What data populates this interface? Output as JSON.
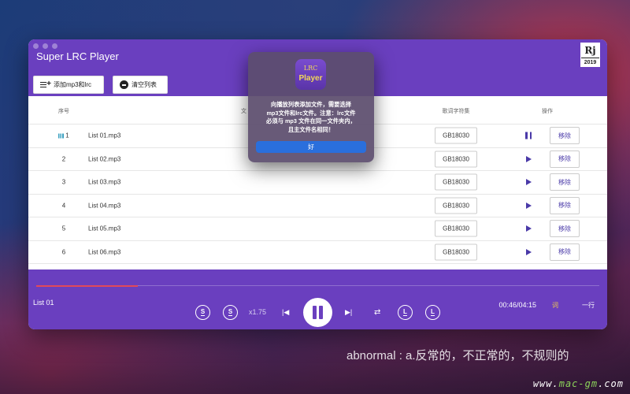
{
  "app": {
    "title": "Super LRC Player",
    "badge_top": "Rj",
    "badge_year": "2019"
  },
  "toolbar": {
    "add_label": "添加mp3和lrc",
    "clear_label": "清空列表"
  },
  "table": {
    "headers": {
      "no": "序号",
      "file": "文",
      "encoding": "歌词字符集",
      "ops": "操作"
    },
    "rows": [
      {
        "no": "1",
        "name": "List 01.mp3",
        "enc": "GB18030",
        "remove": "移除",
        "state": "playing"
      },
      {
        "no": "2",
        "name": "List 02.mp3",
        "enc": "GB18030",
        "remove": "移除",
        "state": "idle"
      },
      {
        "no": "3",
        "name": "List 03.mp3",
        "enc": "GB18030",
        "remove": "移除",
        "state": "idle"
      },
      {
        "no": "4",
        "name": "List 04.mp3",
        "enc": "GB18030",
        "remove": "移除",
        "state": "idle"
      },
      {
        "no": "5",
        "name": "List 05.mp3",
        "enc": "GB18030",
        "remove": "移除",
        "state": "idle"
      },
      {
        "no": "6",
        "name": "List 06.mp3",
        "enc": "GB18030",
        "remove": "移除",
        "state": "idle"
      }
    ]
  },
  "player": {
    "now_playing": "List 01",
    "progress": 0.18,
    "speed": "x1.75",
    "time": "00:46/04:15",
    "lyric_label": "词",
    "line_label": "一行",
    "circle_s": "S",
    "circle_l": "L",
    "progress_color": "#e2495a"
  },
  "dialog": {
    "logo_top": "LRC",
    "logo_bottom": "Player",
    "lines": [
      "向播放列表添加文件，需要选择",
      "mp3文件和lrc文件。注意：lrc文件",
      "必须与 mp3 文件在同一文件夹内，",
      "且主文件名相同！"
    ],
    "ok_label": "好"
  },
  "overlay": {
    "caption": "abnormal : a.反常的，不正常的，不规则的",
    "watermark_pre": "www.",
    "watermark_hi": "mac-gm",
    "watermark_post": ".com"
  },
  "colors": {
    "accent": "#6a3fbf",
    "dialog_button": "#2a6fdc",
    "lyric_active": "#f2cd4a"
  }
}
